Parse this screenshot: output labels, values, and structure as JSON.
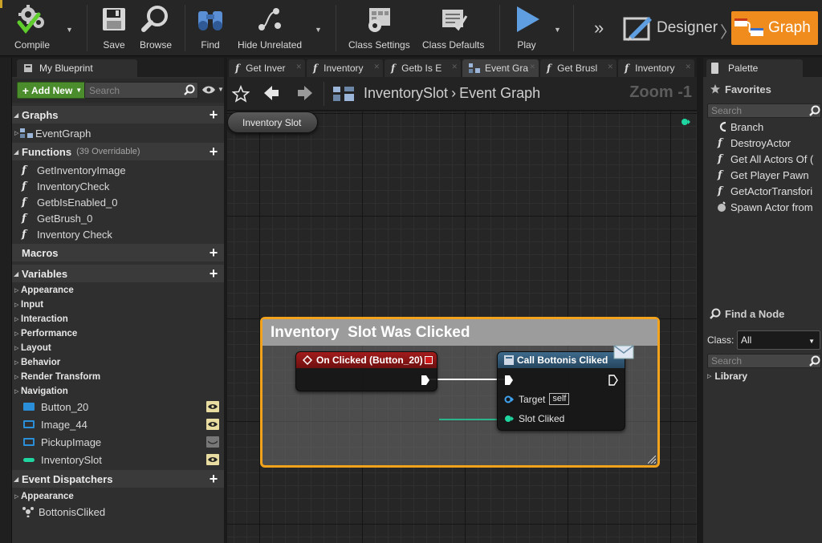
{
  "toolbar": {
    "compile_label": "Compile",
    "save_label": "Save",
    "browse_label": "Browse",
    "find_label": "Find",
    "hide_unrelated_label": "Hide Unrelated",
    "class_settings_label": "Class Settings",
    "class_defaults_label": "Class Defaults",
    "play_label": "Play",
    "designer_label": "Designer",
    "graph_label": "Graph",
    "accent_color": "#f08c1e"
  },
  "left_panel": {
    "tab_title": "My Blueprint",
    "add_new_label": "Add New",
    "search_placeholder": "Search",
    "graphs": {
      "title": "Graphs",
      "items": [
        "EventGraph"
      ]
    },
    "functions": {
      "title": "Functions",
      "subtitle": "(39 Overridable)",
      "items": [
        "GetInventoryImage",
        "InventoryCheck",
        "GetbIsEnabled_0",
        "GetBrush_0",
        "Inventory Check"
      ]
    },
    "macros": {
      "title": "Macros"
    },
    "variables": {
      "title": "Variables",
      "categories": [
        "Appearance",
        "Input",
        "Interaction",
        "Performance",
        "Layout",
        "Behavior",
        "Render Transform",
        "Navigation"
      ],
      "items": [
        {
          "name": "Button_20",
          "color": "#2a8fd8",
          "visible": true
        },
        {
          "name": "Image_44",
          "color": "#2a8fd8",
          "visible": true
        },
        {
          "name": "PickupImage",
          "color": "#2a8fd8",
          "visible": false
        },
        {
          "name": "InventorySlot",
          "color": "#20d6a0",
          "visible": true
        }
      ]
    },
    "event_dispatchers": {
      "title": "Event Dispatchers",
      "categories": [
        "Appearance"
      ],
      "items": [
        "BottonisCliked"
      ]
    }
  },
  "doc_tabs": [
    {
      "label": "Get Inver",
      "icon": "function-icon",
      "active": false
    },
    {
      "label": "Inventory",
      "icon": "function-icon",
      "active": false
    },
    {
      "label": "Getb Is E",
      "icon": "function-icon",
      "active": false
    },
    {
      "label": "Event Gra",
      "icon": "event-graph-icon",
      "active": true
    },
    {
      "label": "Get Brusl",
      "icon": "function-icon",
      "active": false
    },
    {
      "label": "Inventory",
      "icon": "function-icon",
      "active": false
    }
  ],
  "graph": {
    "breadcrumb_root": "InventorySlot",
    "breadcrumb_current": "Event Graph",
    "zoom_label": "Zoom -1",
    "comment_title": "Inventory  Slot Was Clicked",
    "comment_color": "#f2a31b",
    "on_clicked_node": {
      "title": "On Clicked (Button_20)"
    },
    "call_node": {
      "title": "Call Bottonis Cliked",
      "target_label": "Target",
      "target_value": "self",
      "slot_label": "Slot Cliked"
    },
    "var_node": {
      "label": "Inventory Slot"
    }
  },
  "right_panel": {
    "tab_title": "Palette",
    "favorites_title": "Favorites",
    "search_placeholder": "Search",
    "favorites": [
      {
        "label": "Branch",
        "icon": "branch-icon"
      },
      {
        "label": "DestroyActor",
        "icon": "function-icon"
      },
      {
        "label": "Get All Actors Of (",
        "icon": "function-icon"
      },
      {
        "label": "Get Player Pawn",
        "icon": "function-icon"
      },
      {
        "label": "GetActorTransfori",
        "icon": "function-icon"
      },
      {
        "label": "Spawn Actor from",
        "icon": "spawn-icon"
      }
    ],
    "find_node_title": "Find a Node",
    "class_label": "Class:",
    "class_value": "All",
    "library_label": "Library"
  }
}
